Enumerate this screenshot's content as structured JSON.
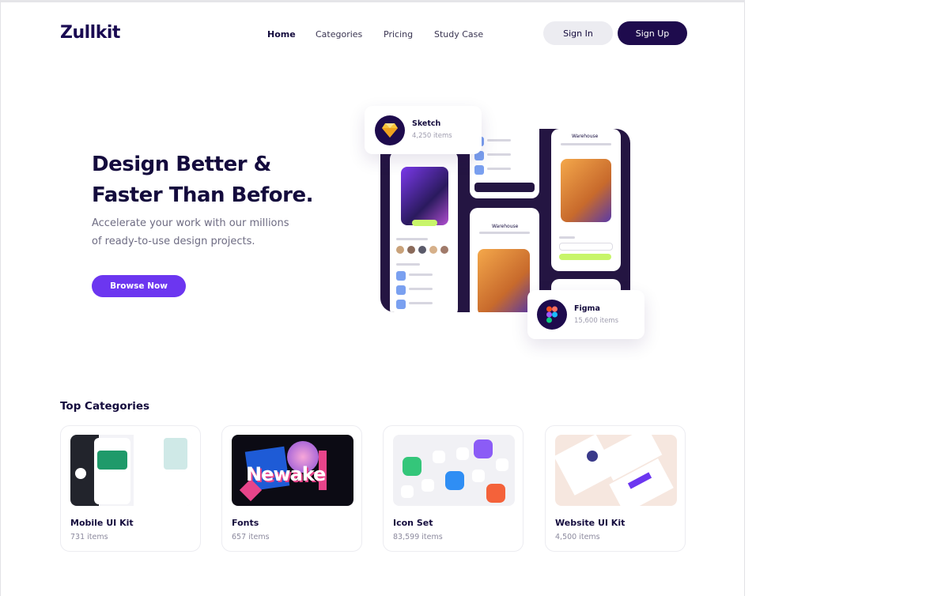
{
  "brand": {
    "logo_text": "Zullkit"
  },
  "nav": {
    "items": [
      {
        "label": "Home",
        "active": true
      },
      {
        "label": "Categories",
        "active": false
      },
      {
        "label": "Pricing",
        "active": false
      },
      {
        "label": "Study Case",
        "active": false
      }
    ],
    "sign_in_label": "Sign In",
    "sign_up_label": "Sign Up"
  },
  "hero": {
    "title_line1": "Design Better &",
    "title_line2": "Faster Than Before.",
    "subtitle_line1": "Accelerate your work with our millions",
    "subtitle_line2": "of ready-to-use design projects.",
    "cta_label": "Browse Now"
  },
  "floating_cards": {
    "sketch": {
      "name": "Sketch",
      "count": "4,250 items",
      "icon": "sketch-diamond-icon"
    },
    "figma": {
      "name": "Figma",
      "count": "15,600 items",
      "icon": "figma-icon"
    }
  },
  "mockup": {
    "warehouse_title": "Warehouse",
    "warehouse_title_2": "Warehouse"
  },
  "categories": {
    "section_title": "Top Categories",
    "items": [
      {
        "name": "Mobile UI Kit",
        "count": "731 items"
      },
      {
        "name": "Fonts",
        "count": "657 items"
      },
      {
        "name": "Icon Set",
        "count": "83,599 items"
      },
      {
        "name": "Website UI Kit",
        "count": "4,500 items"
      }
    ],
    "fonts_thumb_text": "Newake"
  },
  "colors": {
    "brand_dark": "#1e0b4d",
    "accent_purple": "#6c36f0",
    "text_dark": "#140b3d",
    "muted": "#8c8a9e"
  }
}
